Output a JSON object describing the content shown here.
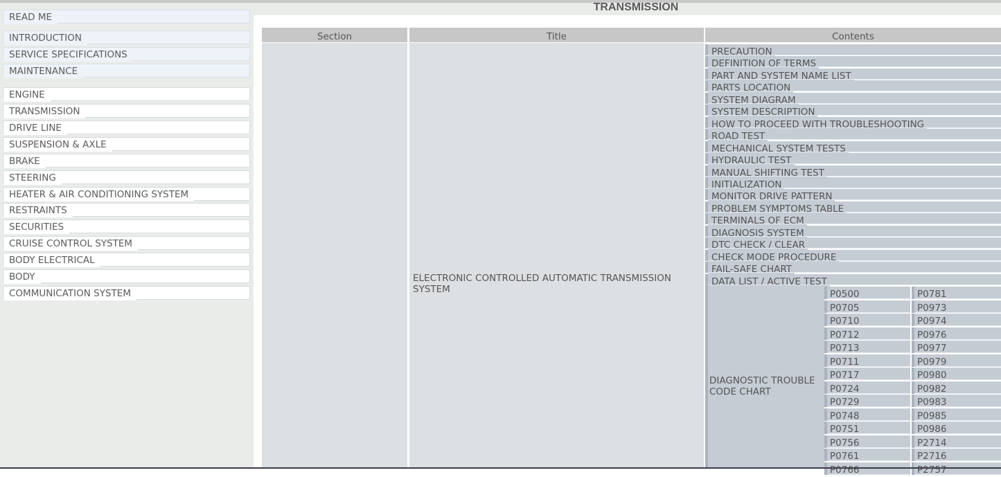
{
  "sidebar": {
    "items": [
      {
        "label": "READ ME",
        "style": "blue"
      },
      {
        "label": "INTRODUCTION",
        "style": "blue"
      },
      {
        "label": "SERVICE SPECIFICATIONS",
        "style": "blue"
      },
      {
        "label": "MAINTENANCE",
        "style": "blue"
      },
      {
        "label": "ENGINE",
        "style": "white"
      },
      {
        "label": "TRANSMISSION",
        "style": "white"
      },
      {
        "label": "DRIVE LINE",
        "style": "white"
      },
      {
        "label": "SUSPENSION & AXLE",
        "style": "white"
      },
      {
        "label": "BRAKE",
        "style": "white"
      },
      {
        "label": "STEERING",
        "style": "white"
      },
      {
        "label": "HEATER & AIR CONDITIONING SYSTEM",
        "style": "white"
      },
      {
        "label": "RESTRAINTS",
        "style": "white"
      },
      {
        "label": "SECURITIES",
        "style": "white"
      },
      {
        "label": "CRUISE CONTROL SYSTEM",
        "style": "white"
      },
      {
        "label": "BODY ELECTRICAL",
        "style": "white"
      },
      {
        "label": "BODY",
        "style": "white"
      },
      {
        "label": "COMMUNICATION SYSTEM",
        "style": "white"
      }
    ]
  },
  "main": {
    "page_title": "TRANSMISSION",
    "table": {
      "headers": {
        "section": "Section",
        "title": "Title",
        "contents": "Contents"
      },
      "row_title": "ELECTRONIC CONTROLLED AUTOMATIC TRANSMISSION SYSTEM",
      "contents": [
        "PRECAUTION",
        "DEFINITION OF TERMS",
        "PART AND SYSTEM NAME LIST",
        "PARTS LOCATION",
        "SYSTEM DIAGRAM",
        "SYSTEM DESCRIPTION",
        "HOW TO PROCEED WITH TROUBLESHOOTING",
        "ROAD TEST",
        "MECHANICAL SYSTEM TESTS",
        "HYDRAULIC TEST",
        "MANUAL SHIFTING TEST",
        "INITIALIZATION",
        "MONITOR DRIVE PATTERN",
        "PROBLEM SYMPTOMS TABLE",
        "TERMINALS OF ECM",
        "DIAGNOSIS SYSTEM",
        "DTC CHECK / CLEAR",
        "CHECK MODE PROCEDURE",
        "FAIL-SAFE CHART",
        "DATA LIST / ACTIVE TEST"
      ],
      "dtc_chart": {
        "label": "DIAGNOSTIC TROUBLE CODE CHART",
        "col1": [
          "P0500",
          "P0705",
          "P0710",
          "P0712",
          "P0713",
          "P0711",
          "P0717",
          "P0724",
          "P0729",
          "P0748",
          "P0751",
          "P0756",
          "P0761",
          "P0766"
        ],
        "col2": [
          "P0781",
          "P0973",
          "P0974",
          "P0976",
          "P0977",
          "P0979",
          "P0980",
          "P0982",
          "P0983",
          "P0985",
          "P0986",
          "P2714",
          "P2716",
          "P2757"
        ]
      }
    }
  }
}
